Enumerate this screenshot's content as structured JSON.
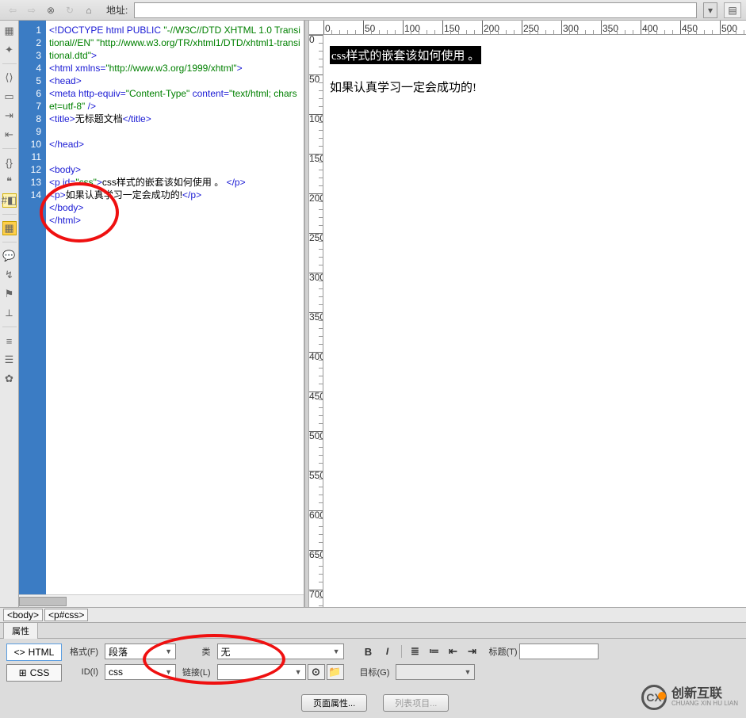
{
  "toolbar": {
    "address_label": "地址:",
    "address_value": ""
  },
  "code": {
    "lines": [
      "1",
      "2",
      "3",
      "4",
      "5",
      "6",
      "7",
      "8",
      "9",
      "10",
      "11",
      "12",
      "13",
      "14"
    ],
    "l1a": "<!DOCTYPE html PUBLIC ",
    "l1b": "\"-//W3C//DTD XHTML 1.0 Transitional//EN\" \"http://www.w3.org/TR/xhtml1/DTD/xhtml1-transitional.dtd\"",
    "l1c": ">",
    "l2a": "<html xmlns=",
    "l2b": "\"http://www.w3.org/1999/xhtml\"",
    "l2c": ">",
    "l3": "<head>",
    "l4a": "<meta http-equiv=",
    "l4b": "\"Content-Type\"",
    "l4c": " content=",
    "l4d": "\"text/html; charset=utf-8\"",
    "l4e": " />",
    "l5a": "<title>",
    "l5b": "无标题文档",
    "l5c": "</title>",
    "l7": "</head>",
    "l9": "<body>",
    "l10a": "<p id=",
    "l10b": "\"css\"",
    "l10c": ">",
    "l10d": "css样式的嵌套该如何使用 。 ",
    "l10e": "</p>",
    "l11a": "<p>",
    "l11b": "如果认真学习一定会成功的!",
    "l11c": "</p>",
    "l12": "</body>",
    "l13": "</html>"
  },
  "ruler": {
    "ticks": [
      "0",
      "50",
      "100",
      "150",
      "200",
      "250",
      "300",
      "350",
      "400",
      "450",
      "500"
    ]
  },
  "preview": {
    "highlighted": "css样式的嵌套该如何使用 。",
    "plain": "如果认真学习一定会成功的!"
  },
  "tagbar": {
    "t1": "<body>",
    "t2": "<p#css>"
  },
  "props": {
    "tab_label": "属性",
    "html_btn": "HTML",
    "css_btn": "CSS",
    "format_label": "格式(F)",
    "format_value": "段落",
    "class_label": "类",
    "class_value": "无",
    "id_label": "ID(I)",
    "id_value": "css",
    "link_label": "链接(L)",
    "link_value": "",
    "title_label": "标题(T)",
    "target_label": "目标(G)",
    "page_props_btn": "页面属性...",
    "list_item_btn": "列表项目..."
  },
  "logo": {
    "mark": "CX",
    "cn": "创新互联",
    "en": "CHUANG XIN HU LIAN"
  }
}
